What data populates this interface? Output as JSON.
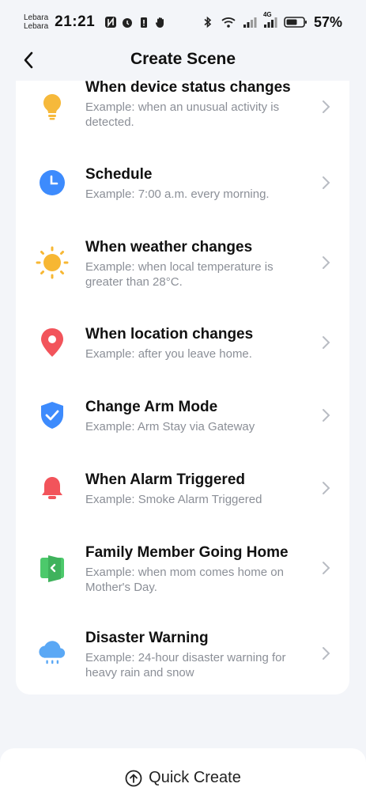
{
  "status_bar": {
    "carrier_line1": "Lebara",
    "carrier_line2": "Lebara",
    "time": "21:21",
    "network_label": "4G",
    "battery_percent": "57%"
  },
  "header": {
    "title": "Create Scene",
    "back_icon": "chevron-left-icon"
  },
  "items": [
    {
      "icon": "lightbulb-icon",
      "title": "When device status changes",
      "desc": "Example: when an unusual activity is detected.",
      "color": "#F6B93B"
    },
    {
      "icon": "clock-icon",
      "title": "Schedule",
      "desc": "Example: 7:00 a.m. every morning.",
      "color": "#3D8BFD"
    },
    {
      "icon": "sun-icon",
      "title": "When weather changes",
      "desc": "Example: when local temperature is greater than 28°C.",
      "color": "#F7B733"
    },
    {
      "icon": "location-pin-icon",
      "title": "When location changes",
      "desc": "Example: after you leave home.",
      "color": "#F2545B"
    },
    {
      "icon": "shield-check-icon",
      "title": "Change Arm Mode",
      "desc": "Example: Arm Stay via Gateway",
      "color": "#3D8BFD"
    },
    {
      "icon": "alarm-bell-icon",
      "title": "When Alarm Triggered",
      "desc": "Example: Smoke Alarm Triggered",
      "color": "#F2545B"
    },
    {
      "icon": "door-home-icon",
      "title": "Family Member Going Home",
      "desc": "Example: when mom comes home on Mother's Day.",
      "color": "#4CC96B"
    },
    {
      "icon": "rain-cloud-icon",
      "title": "Disaster Warning",
      "desc": "Example: 24-hour disaster warning for heavy rain and snow",
      "color": "#5AA8F5"
    }
  ],
  "bottom": {
    "quick_create_label": "Quick Create",
    "quick_create_icon": "arrow-up-circle-icon"
  }
}
